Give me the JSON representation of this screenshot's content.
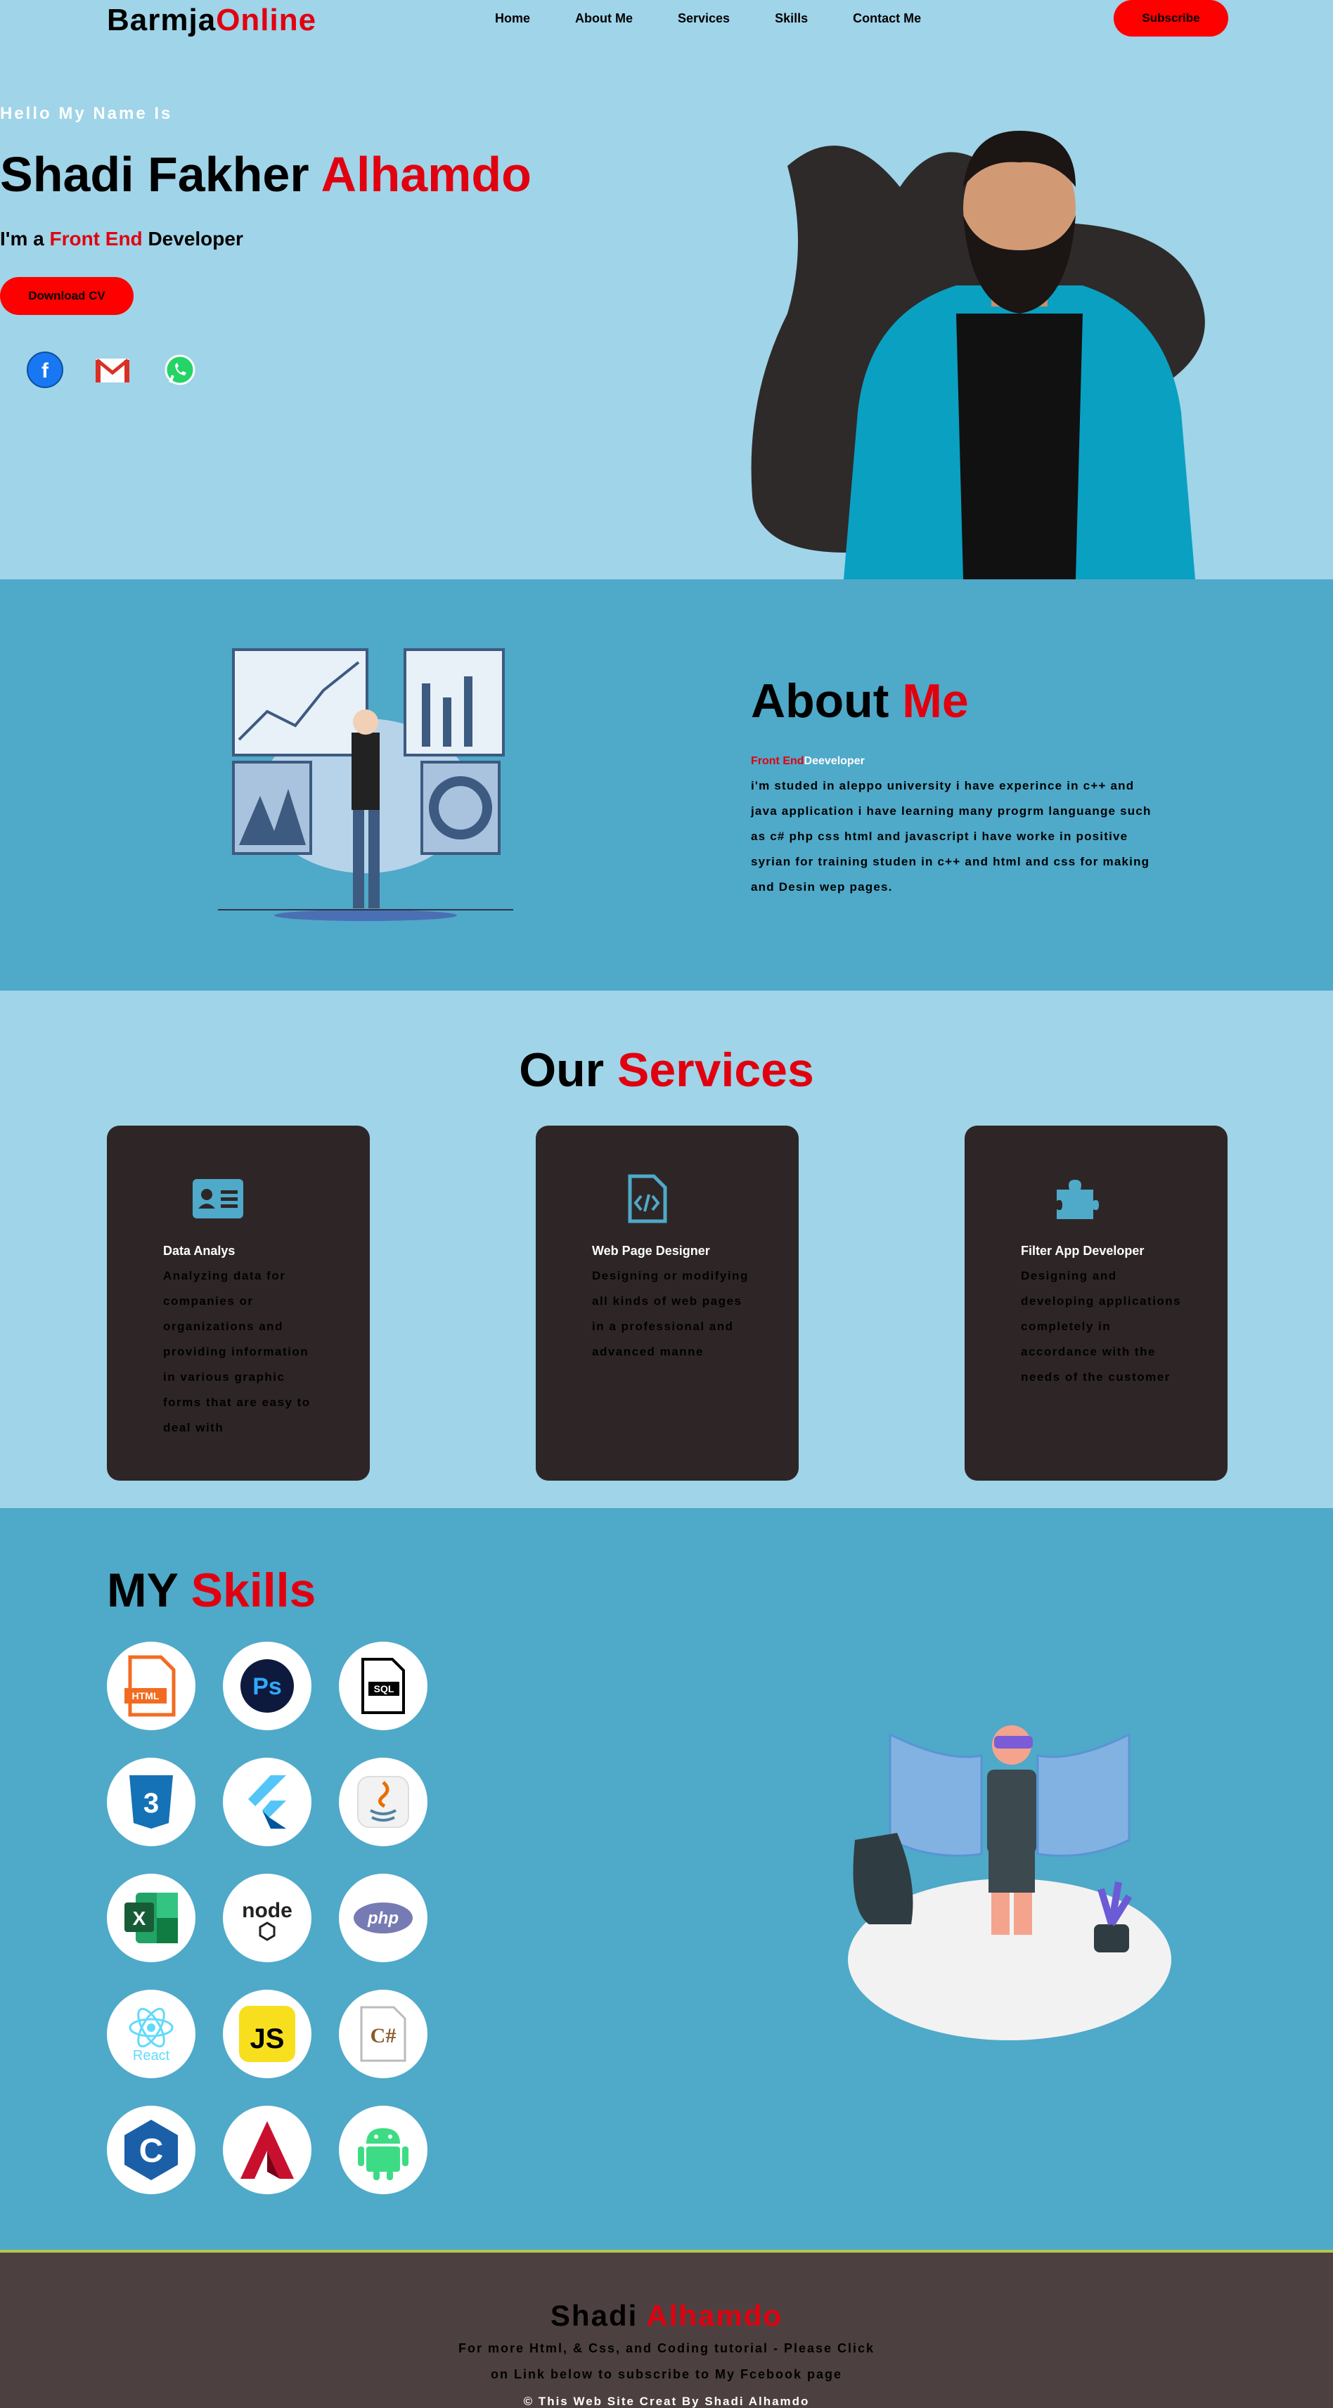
{
  "header": {
    "logo_part1": "Barmja",
    "logo_part2": "Online",
    "nav": [
      "Home",
      "About Me",
      "Services",
      "Skills",
      "Contact Me"
    ],
    "subscribe_label": "Subscribe"
  },
  "hero": {
    "greeting": "Hello My Name Is",
    "name_part1": "Shadi Fakher ",
    "name_part2": "Alhamdo",
    "role_prefix": "I'm a ",
    "role_highlight": "Front End",
    "role_suffix": " Developer",
    "cv_label": "Download CV",
    "socials": [
      "facebook-icon",
      "gmail-icon",
      "whatsapp-icon"
    ]
  },
  "about": {
    "title_part1": "About ",
    "title_part2": "Me",
    "sub_red": "Front End",
    "sub_white": "Deeveloper",
    "text": "i'm studed in aleppo university i have experince in c++ and java application i have learning many progrm languange such as c# php css html and javascript i have worke in positive syrian for training studen in c++ and html and css for making and Desin wep pages."
  },
  "services": {
    "title_part1": "Our ",
    "title_part2": "Services",
    "cards": [
      {
        "icon": "id-card-icon",
        "title": "Data Analys",
        "text": "Analyzing data for companies or organizations and providing information in various graphic forms that are easy to deal with"
      },
      {
        "icon": "code-file-icon",
        "title": "Web Page Designer",
        "text": "Designing or modifying all kinds of web pages in a professional and advanced manne"
      },
      {
        "icon": "puzzle-icon",
        "title": "Filter App Developer",
        "text": "Designing and developing applications completely in accordance with the needs of the customer"
      }
    ]
  },
  "skills": {
    "title_part1": "MY ",
    "title_part2": "Skills",
    "icons": [
      "html-icon",
      "photoshop-icon",
      "sql-icon",
      "css3-icon",
      "flutter-icon",
      "java-icon",
      "excel-icon",
      "nodejs-icon",
      "php-icon",
      "react-icon",
      "javascript-icon",
      "csharp-icon",
      "c-icon",
      "autocad-icon",
      "android-icon"
    ],
    "labels": {
      "html": "HTML",
      "ps": "Ps",
      "sql": "SQL",
      "css": "3",
      "excel": "X",
      "node": "node",
      "php": "php",
      "react": "React",
      "js": "JS",
      "cs": "C#",
      "c": "C"
    }
  },
  "footer": {
    "title_part1": "Shadi ",
    "title_part2": "Alhamdo",
    "line1": "For more Html, & Css, and Coding tutorial - Please Click",
    "line2": "on Link below to subscribe to My Fcebook page",
    "copyright": "© This Web Site Creat By Shadi Alhamdo"
  }
}
